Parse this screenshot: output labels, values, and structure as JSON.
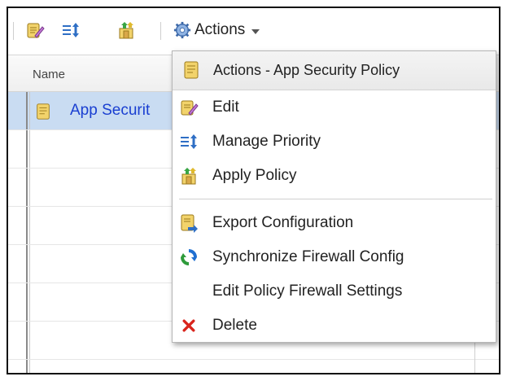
{
  "toolbar": {
    "edit_icon": "edit-policy-icon",
    "priority_icon": "manage-priority-icon",
    "apply_icon": "apply-policy-icon",
    "actions_label": "Actions"
  },
  "grid": {
    "columns": [
      "Name"
    ],
    "rows": [
      {
        "name": "App Securit",
        "selected": true
      }
    ]
  },
  "menu": {
    "header": "Actions - App Security Policy",
    "items": [
      {
        "label": "Edit",
        "icon": "edit-icon"
      },
      {
        "label": "Manage Priority",
        "icon": "manage-priority-icon"
      },
      {
        "label": "Apply Policy",
        "icon": "apply-policy-icon"
      },
      {
        "label": "Export Configuration",
        "icon": "export-icon"
      },
      {
        "label": "Synchronize Firewall Config",
        "icon": "sync-icon"
      },
      {
        "label": "Edit Policy Firewall Settings",
        "icon": ""
      },
      {
        "label": "Delete",
        "icon": "delete-icon"
      }
    ]
  },
  "colors": {
    "selected_row": "#c9dcf2",
    "link_text": "#1a3fd1",
    "delete_red": "#d9241c",
    "sync_blue": "#1f6fd1",
    "sync_green": "#2e9b3a"
  }
}
